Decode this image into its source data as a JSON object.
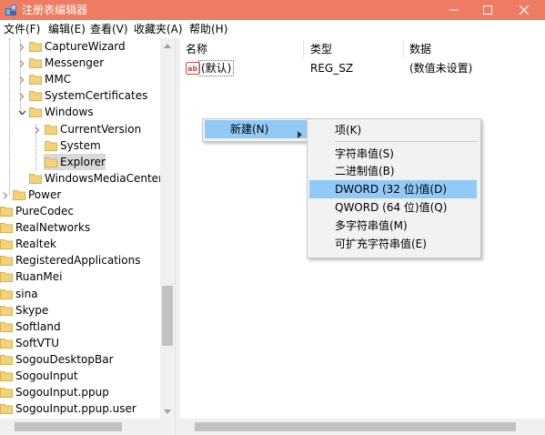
{
  "window": {
    "title": "注册表编辑器",
    "accent_color": "#ee7c63"
  },
  "menubar": {
    "items": [
      "文件(F)",
      "编辑(E)",
      "查看(V)",
      "收藏夹(A)",
      "帮助(H)"
    ]
  },
  "tree": {
    "nodes": [
      {
        "label": "CaptureWizard",
        "level": 2,
        "expander": "collapsed"
      },
      {
        "label": "Messenger",
        "level": 2,
        "expander": "collapsed"
      },
      {
        "label": "MMC",
        "level": 2,
        "expander": "collapsed"
      },
      {
        "label": "SystemCertificates",
        "level": 2,
        "expander": "collapsed"
      },
      {
        "label": "Windows",
        "level": 2,
        "expander": "expanded"
      },
      {
        "label": "CurrentVersion",
        "level": 3,
        "expander": "collapsed"
      },
      {
        "label": "System",
        "level": 3,
        "expander": "none"
      },
      {
        "label": "Explorer",
        "level": 3,
        "expander": "none",
        "selected": true
      },
      {
        "label": "WindowsMediaCenter",
        "level": 2,
        "expander": "none"
      },
      {
        "label": "Power",
        "level": 1,
        "expander": "collapsed"
      },
      {
        "label": "PureCodec",
        "level": 0,
        "expander": "none"
      },
      {
        "label": "RealNetworks",
        "level": 0,
        "expander": "none"
      },
      {
        "label": "Realtek",
        "level": 0,
        "expander": "none"
      },
      {
        "label": "RegisteredApplications",
        "level": 0,
        "expander": "none"
      },
      {
        "label": "RuanMei",
        "level": 0,
        "expander": "none"
      },
      {
        "label": "sina",
        "level": 0,
        "expander": "none"
      },
      {
        "label": "Skype",
        "level": 0,
        "expander": "none"
      },
      {
        "label": "Softland",
        "level": 0,
        "expander": "none"
      },
      {
        "label": "SoftVTU",
        "level": 0,
        "expander": "none"
      },
      {
        "label": "SogouDesktopBar",
        "level": 0,
        "expander": "none"
      },
      {
        "label": "SogouInput",
        "level": 0,
        "expander": "none"
      },
      {
        "label": "SogouInput.ppup",
        "level": 0,
        "expander": "none"
      },
      {
        "label": "SogouInput.ppup.user",
        "level": 0,
        "expander": "none"
      }
    ]
  },
  "list": {
    "columns": [
      "名称",
      "类型",
      "数据"
    ],
    "rows": [
      {
        "icon": "string-value-icon",
        "name": "(默认)",
        "type": "REG_SZ",
        "data": "(数值未设置)"
      }
    ]
  },
  "context_menu": {
    "new_label": "新建(N)",
    "submenu": {
      "items": [
        {
          "label": "项(K)"
        },
        {
          "label": "字符串值(S)"
        },
        {
          "label": "二进制值(B)"
        },
        {
          "label": "DWORD (32 位)值(D)",
          "highlighted": true
        },
        {
          "label": "QWORD (64 位)值(Q)"
        },
        {
          "label": "多字符串值(M)"
        },
        {
          "label": "可扩充字符串值(E)"
        }
      ]
    }
  }
}
